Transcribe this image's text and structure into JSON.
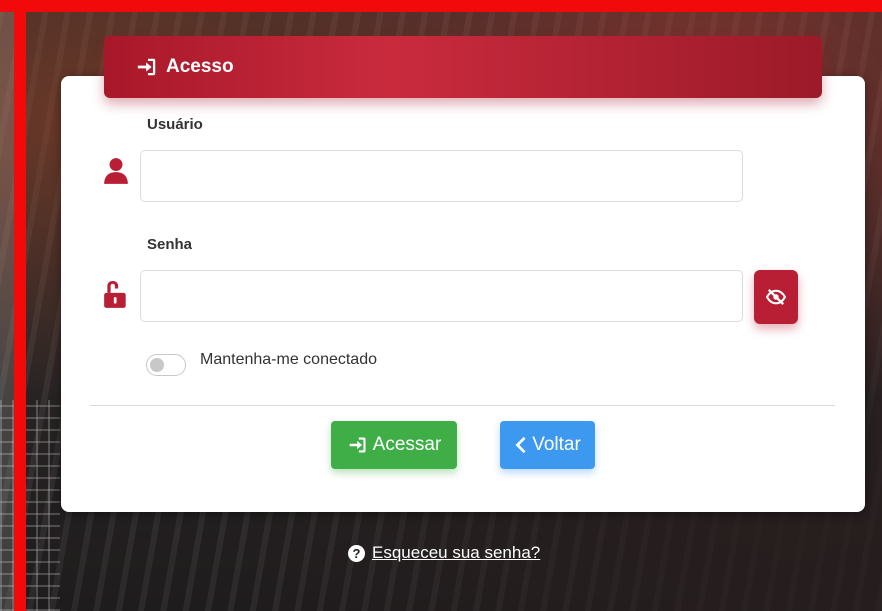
{
  "header": {
    "title": "Acesso",
    "icon": "sign-in-icon"
  },
  "form": {
    "username": {
      "label": "Usuário",
      "value": "",
      "placeholder": "",
      "icon": "user-icon"
    },
    "password": {
      "label": "Senha",
      "value": "",
      "placeholder": "",
      "icon": "unlock-icon",
      "visibility_toggle_icon": "eye-slash-icon"
    },
    "remember": {
      "label": "Mantenha-me conectado",
      "checked": false
    }
  },
  "actions": {
    "submit_label": "Acessar",
    "submit_icon": "sign-in-icon",
    "back_label": "Voltar",
    "back_icon": "chevron-left-icon"
  },
  "forgot": {
    "link_text": "Esqueceu sua senha?",
    "icon": "question-circle-icon"
  },
  "colors": {
    "primary": "#b81f34",
    "success": "#3fae47",
    "info": "#3d98f0",
    "frame": "#f20a0a"
  }
}
